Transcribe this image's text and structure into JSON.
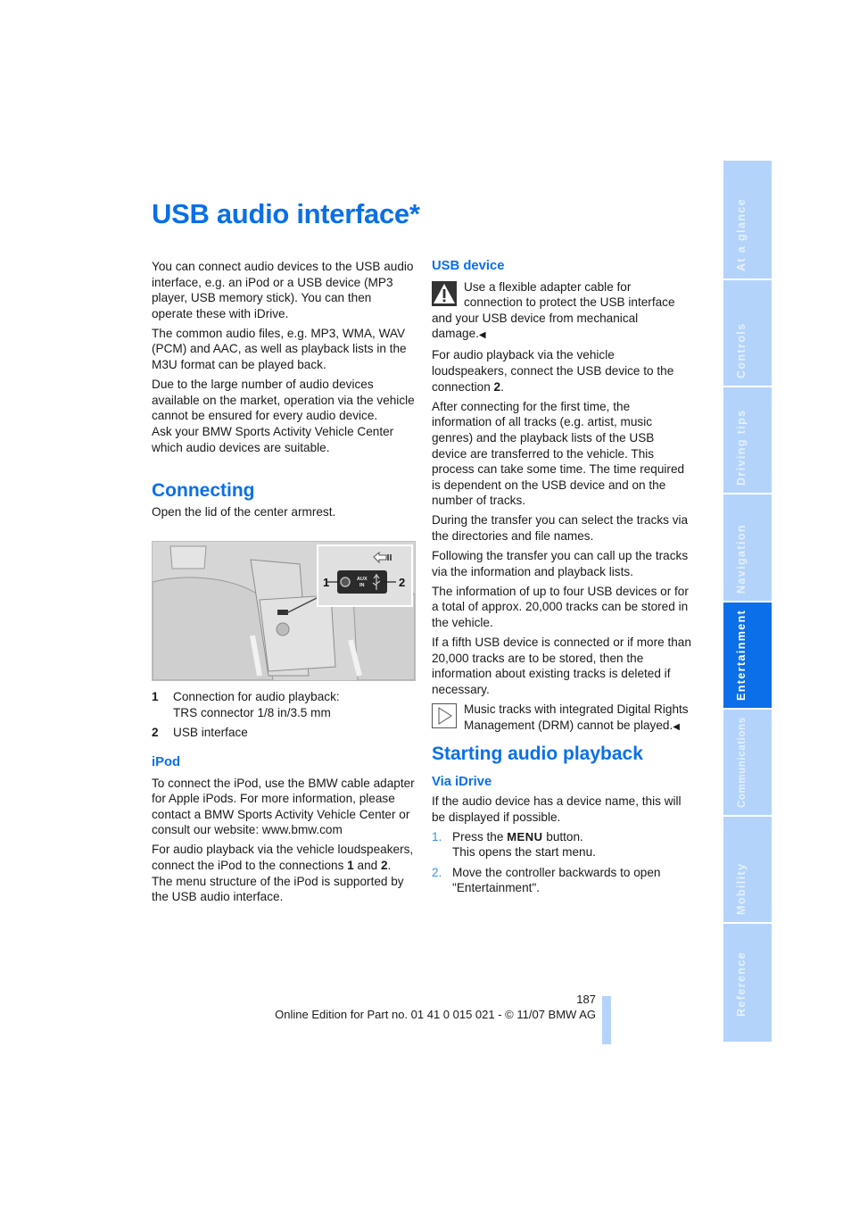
{
  "page": {
    "title": "USB audio interface*",
    "page_number": "187",
    "footer_text": "Online Edition for Part no. 01 41 0 015 021 - © 11/07 BMW AG"
  },
  "sidebar": {
    "tabs": [
      {
        "label": "At a glance",
        "active": false
      },
      {
        "label": "Controls",
        "active": false
      },
      {
        "label": "Driving tips",
        "active": false
      },
      {
        "label": "Navigation",
        "active": false
      },
      {
        "label": "Entertainment",
        "active": true
      },
      {
        "label": "Communications",
        "active": false
      },
      {
        "label": "Mobility",
        "active": false
      },
      {
        "label": "Reference",
        "active": false
      }
    ],
    "active_color": "#0a6fe8",
    "inactive_color": "#b3d3fb"
  },
  "left": {
    "intro": [
      "You can connect audio devices to the USB audio interface, e.g. an iPod or a USB device (MP3 player, USB memory stick). You can then operate these with iDrive.",
      "The common audio files, e.g. MP3, WMA, WAV (PCM) and AAC, as well as playback lists in the M3U format can be played back.",
      "Due to the large number of audio devices available on the market, operation via the vehicle cannot be ensured for every audio device.",
      "Ask your BMW Sports Activity Vehicle Center which audio devices are suitable."
    ],
    "connecting": {
      "heading": "Connecting",
      "text": "Open the lid of the center armrest.",
      "figure": {
        "callout_1": "1",
        "callout_2": "2",
        "aux_label_1": "AUX",
        "aux_label_2": "IN"
      },
      "legend": [
        {
          "num": "1",
          "line1": "Connection for audio playback:",
          "line2": "TRS connector 1/8 in/3.5 mm"
        },
        {
          "num": "2",
          "line1": "USB interface",
          "line2": ""
        }
      ]
    },
    "ipod": {
      "heading": "iPod",
      "p1": "To connect the iPod, use the BMW cable adapter for Apple iPods. For more information, please contact a BMW Sports Activity Vehicle Center or consult our website: www.bmw.com",
      "p2_pre": "For audio playback via the vehicle loudspeakers, connect the iPod to the connections ",
      "p2_b1": "1",
      "p2_mid": " and ",
      "p2_b2": "2",
      "p2_post": ".",
      "p3": "The menu structure of the iPod is supported by the USB audio interface."
    }
  },
  "right": {
    "usb_device": {
      "heading": "USB device",
      "warning": "Use a flexible adapter cable for connection to protect the USB interface and your USB device from mechanical damage.",
      "p1_pre": "For audio playback via the vehicle loudspeakers, connect the USB device to the connection ",
      "p1_b": "2",
      "p1_post": ".",
      "p2": "After connecting for the first time, the information of all tracks (e.g. artist, music genres) and the playback lists of the USB device are transferred to the vehicle. This process can take some time. The time required is dependent on the USB device and on the number of tracks.",
      "p3": "During the transfer you can select the tracks via the directories and file names.",
      "p4": "Following the transfer you can call up the tracks via the information and playback lists.",
      "p5": "The information of up to four USB devices or for a total of approx. 20,000 tracks can be stored in the vehicle.",
      "p6": "If a fifth USB device is connected or if more than 20,000 tracks are to be stored, then the information about existing tracks is deleted if necessary.",
      "note": "Music tracks with integrated Digital Rights Management (DRM) cannot be played."
    },
    "starting": {
      "heading": "Starting audio playback",
      "subheading": "Via iDrive",
      "text": "If the audio device has a device name, this will be displayed if possible.",
      "steps": [
        {
          "num": "1.",
          "pre": "Press the ",
          "key": "MENU",
          "post": " button.",
          "line2": "This opens the start menu."
        },
        {
          "num": "2.",
          "pre": "Move the controller backwards to open \"Entertainment\".",
          "key": "",
          "post": "",
          "line2": ""
        }
      ]
    },
    "end_mark": "◀"
  }
}
